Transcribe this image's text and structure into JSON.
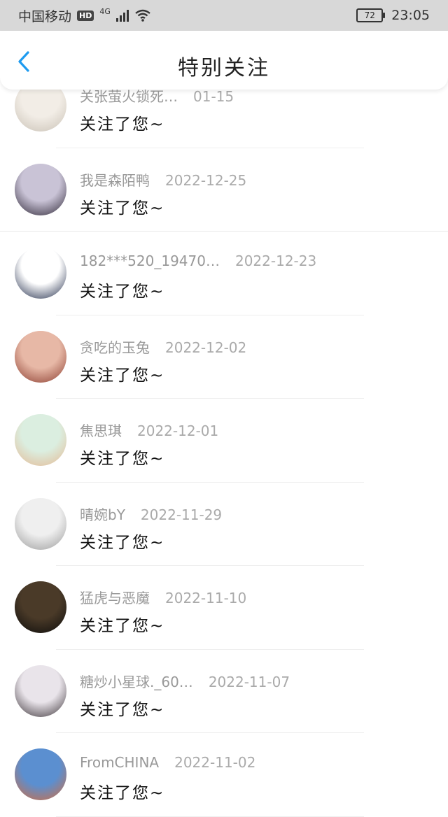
{
  "status_bar": {
    "carrier": "中国移动",
    "hd": "HD",
    "network": "4G",
    "battery": "72",
    "time": "23:05"
  },
  "header": {
    "title": "特别关注",
    "back_icon": "chevron-left-icon"
  },
  "colors": {
    "accent": "#1e9bf0",
    "status_bar_bg": "#d8d8d8"
  },
  "followers": [
    {
      "name": "关张萤火锁死…",
      "date": "01-15",
      "message": "关注了您~",
      "avatar": {
        "a": "#f2ede6",
        "b": "#c8c0b4"
      }
    },
    {
      "name": "我是森陌鸭",
      "date": "2022-12-25",
      "message": "关注了您~",
      "avatar": {
        "a": "#c9c3d6",
        "b": "#2b2433"
      }
    },
    {
      "name": "182***520_19470…",
      "date": "2022-12-23",
      "message": "关注了您~",
      "avatar": {
        "a": "#ffffff",
        "b": "#1f2a48"
      }
    },
    {
      "name": "贪吃的玉兔",
      "date": "2022-12-02",
      "message": "关注了您~",
      "avatar": {
        "a": "#e7b8a6",
        "b": "#8a3b2e"
      }
    },
    {
      "name": "焦思琪",
      "date": "2022-12-01",
      "message": "关注了您~",
      "avatar": {
        "a": "#dbeee0",
        "b": "#e4b892"
      }
    },
    {
      "name": "晴婉bY",
      "date": "2022-11-29",
      "message": "关注了您~",
      "avatar": {
        "a": "#efefef",
        "b": "#9a9a9a"
      }
    },
    {
      "name": "猛虎与恶魔",
      "date": "2022-11-10",
      "message": "关注了您~",
      "avatar": {
        "a": "#4a3a28",
        "b": "#0b0b0b"
      }
    },
    {
      "name": "糖炒小星球._60…",
      "date": "2022-11-07",
      "message": "关注了您~",
      "avatar": {
        "a": "#e9e4ea",
        "b": "#3b3338"
      }
    },
    {
      "name": "FromCHINA",
      "date": "2022-11-02",
      "message": "关注了您~",
      "avatar": {
        "a": "#5b8fd0",
        "b": "#d66b3a"
      }
    }
  ]
}
